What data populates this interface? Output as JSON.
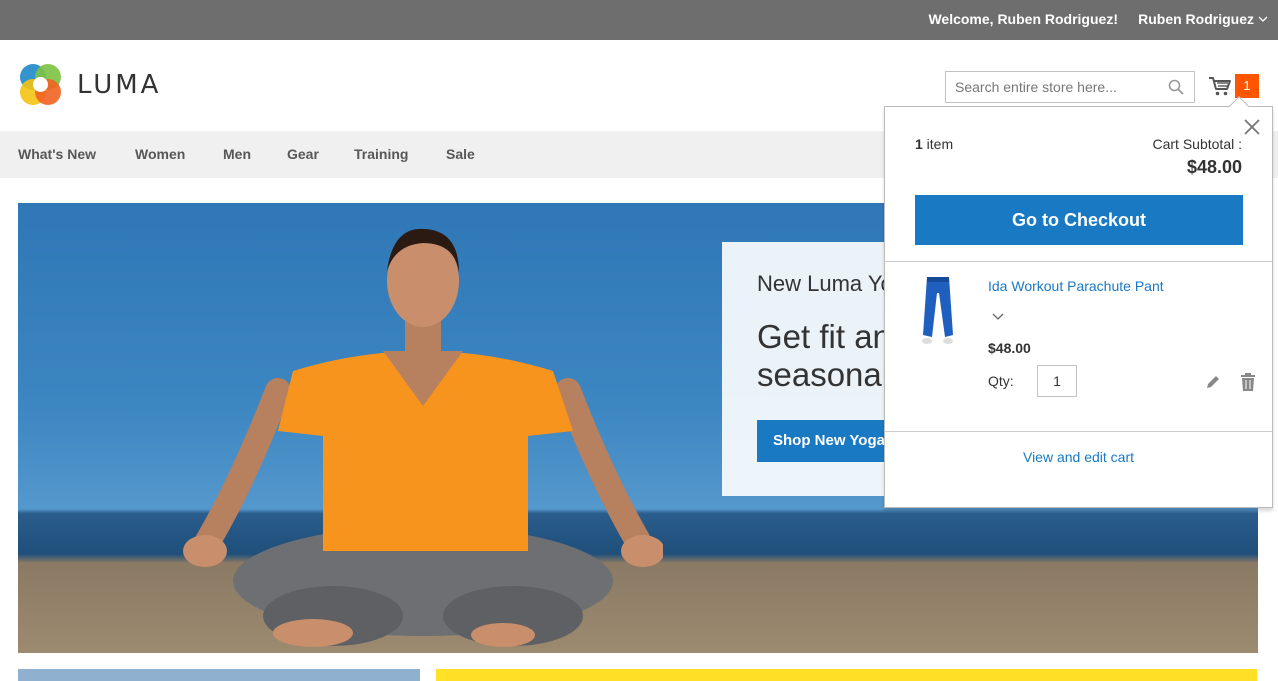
{
  "topbar": {
    "welcome": "Welcome, Ruben Rodriguez!",
    "account_name": "Ruben Rodriguez"
  },
  "header": {
    "logo_text": "LUMA",
    "search_placeholder": "Search entire store here...",
    "cart_count": "1"
  },
  "nav": {
    "items": [
      "What's New",
      "Women",
      "Men",
      "Gear",
      "Training",
      "Sale"
    ]
  },
  "hero": {
    "kicker": "New Luma Yoga Collection",
    "headline_line1": "Get fit and look fab in new",
    "headline_line2": "seasonal styles",
    "cta": "Shop New Yoga"
  },
  "minicart": {
    "count": "1",
    "count_label": " item",
    "subtotal_label": "Cart Subtotal :",
    "subtotal_amount": "$48.00",
    "checkout_label": "Go to Checkout",
    "item": {
      "name": "Ida Workout Parachute Pant",
      "price": "$48.00",
      "qty_label": "Qty:",
      "qty_value": "1"
    },
    "view_cart_label": "View and edit cart"
  },
  "colors": {
    "accent_blue": "#1979c3",
    "cart_counter": "#ff5501",
    "topbar_bg": "#6e6e6e",
    "nav_bg": "#f0f0f0"
  },
  "icons": [
    "chevron-down-icon",
    "luma-logo-icon",
    "search-icon",
    "cart-icon",
    "close-icon",
    "edit-icon",
    "trash-icon"
  ]
}
